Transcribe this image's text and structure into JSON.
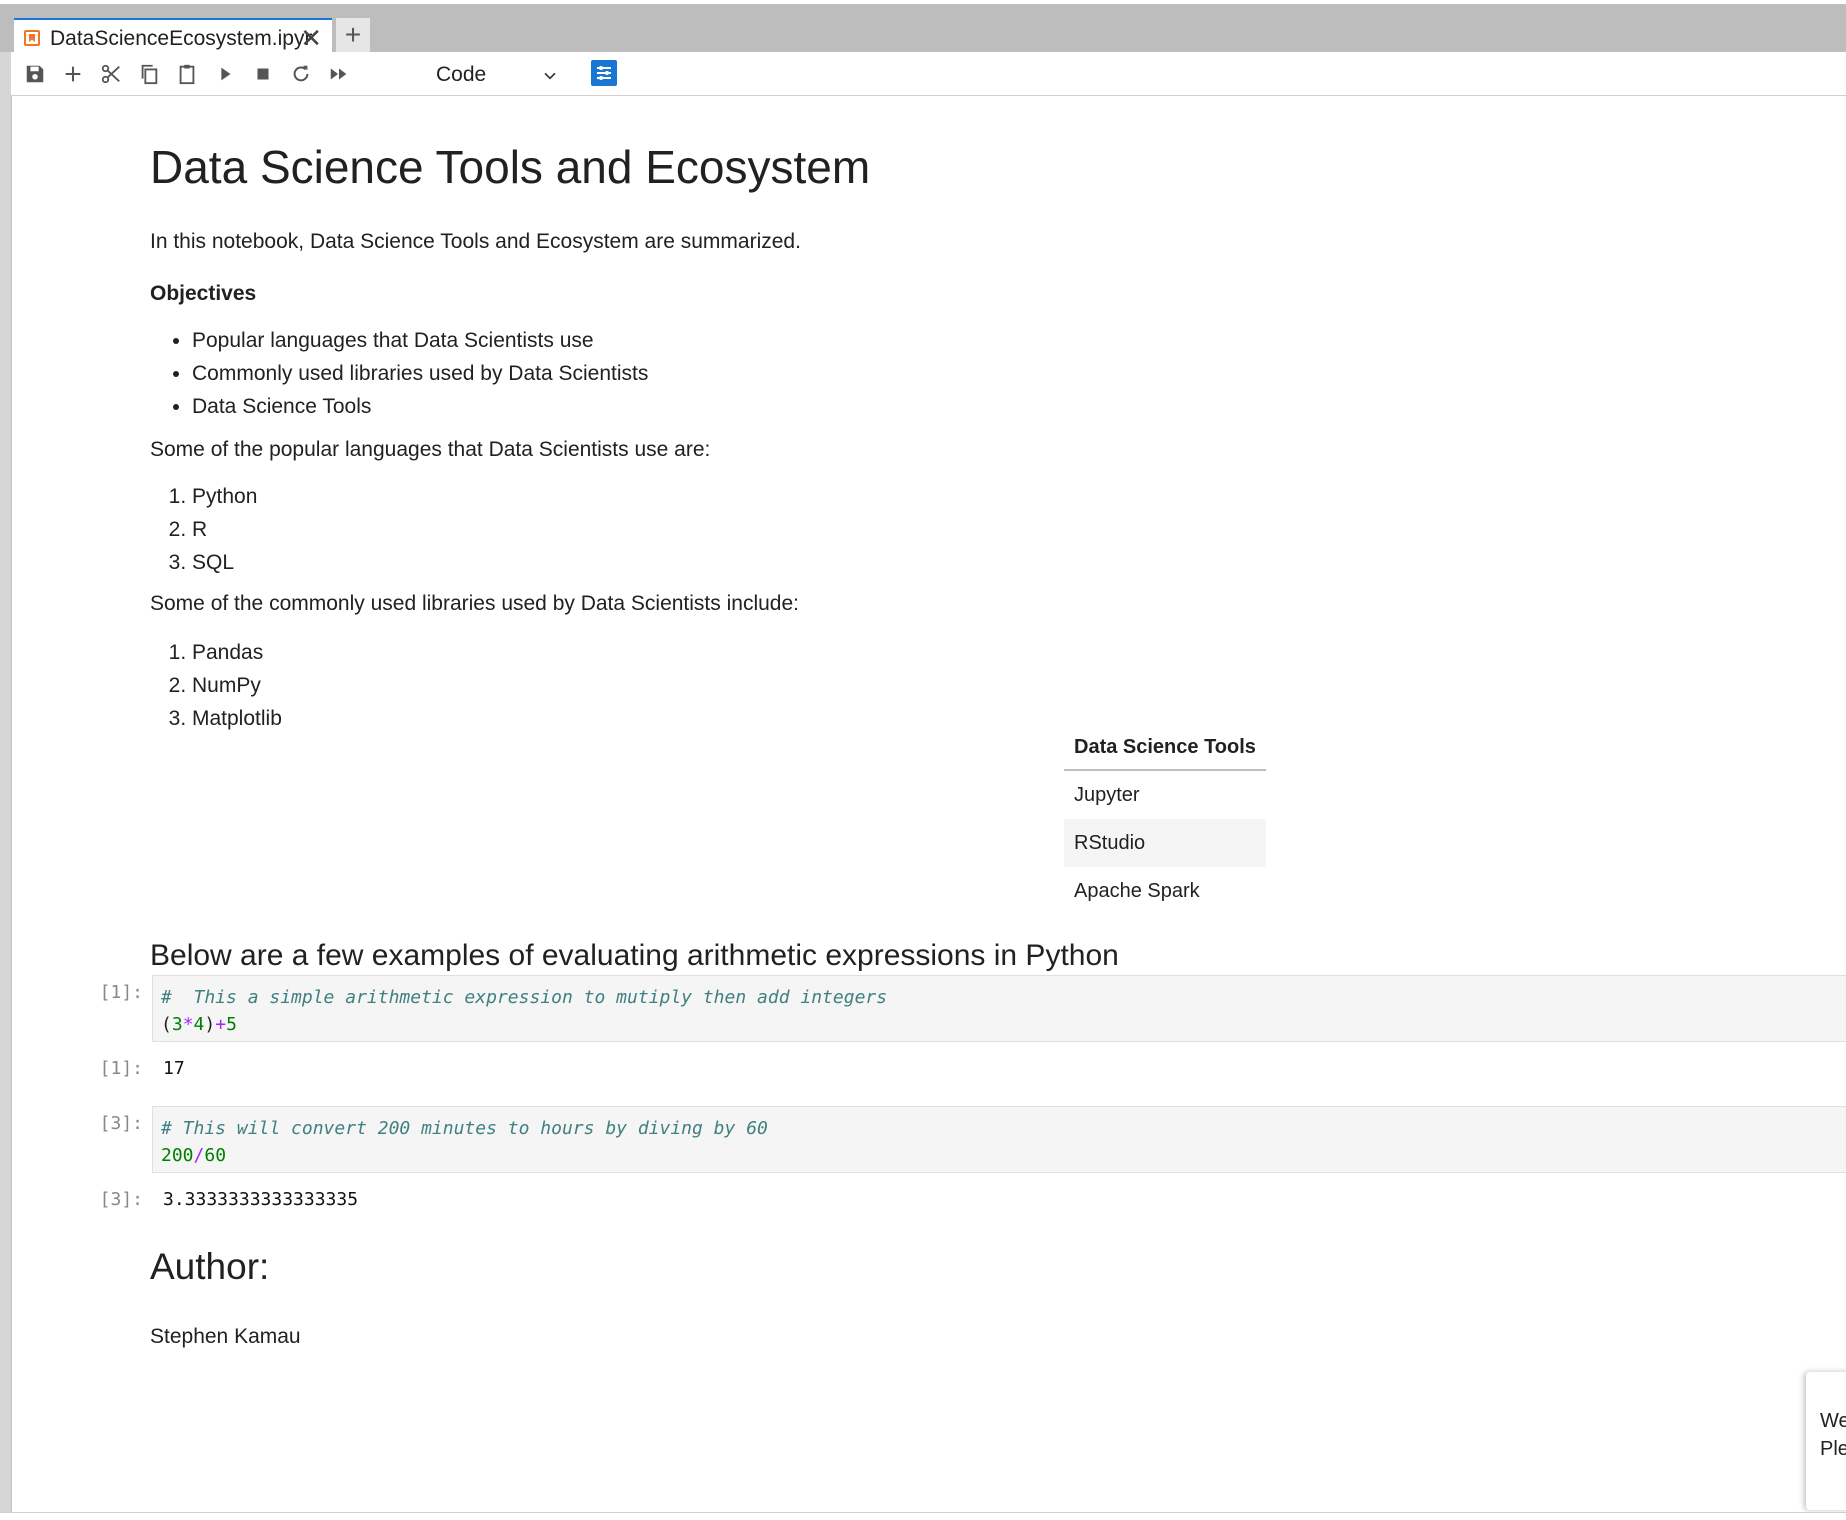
{
  "tab": {
    "title": "DataScienceEcosystem.ipynb",
    "close": "✕",
    "add": "+"
  },
  "toolbar": {
    "icons": [
      "save-icon",
      "add-cell-icon",
      "cut-icon",
      "copy-icon",
      "paste-icon",
      "run-icon",
      "stop-icon",
      "restart-icon",
      "run-all-icon",
      "property-inspector-icon"
    ],
    "cell_type": "Code"
  },
  "notebook": {
    "title": "Data Science Tools and Ecosystem",
    "intro": "In this notebook, Data Science Tools and Ecosystem are summarized.",
    "objectives_heading": "Objectives",
    "objectives": [
      "Popular languages that Data Scientists use",
      "Commonly used libraries used by Data Scientists",
      "Data Science Tools"
    ],
    "languages_intro": "Some of the popular languages that Data Scientists use are:",
    "languages": [
      "Python",
      "R",
      "SQL"
    ],
    "libraries_intro": "Some of the commonly used libraries used by Data Scientists include:",
    "libraries": [
      "Pandas",
      "NumPy",
      "Matplotlib"
    ],
    "tools_table": {
      "header": "Data Science Tools",
      "rows": [
        "Jupyter",
        "RStudio",
        "Apache Spark"
      ]
    },
    "examples_heading": "Below are a few examples of evaluating arithmetic expressions in Python",
    "cells": [
      {
        "prompt": "[1]:",
        "comment": "#  This a simple arithmetic expression to mutiply then add integers",
        "code": "(3*4)+5",
        "out_prompt": "[1]:",
        "output": "17"
      },
      {
        "prompt": "[3]:",
        "comment": "# This will convert 200 minutes to hours by diving by 60",
        "code": "200/60",
        "out_prompt": "[3]:",
        "output": "3.3333333333333335"
      }
    ],
    "author_heading": "Author:",
    "author_name": "Stephen Kamau"
  },
  "toast": {
    "line1": "We",
    "line2": "Ple"
  }
}
